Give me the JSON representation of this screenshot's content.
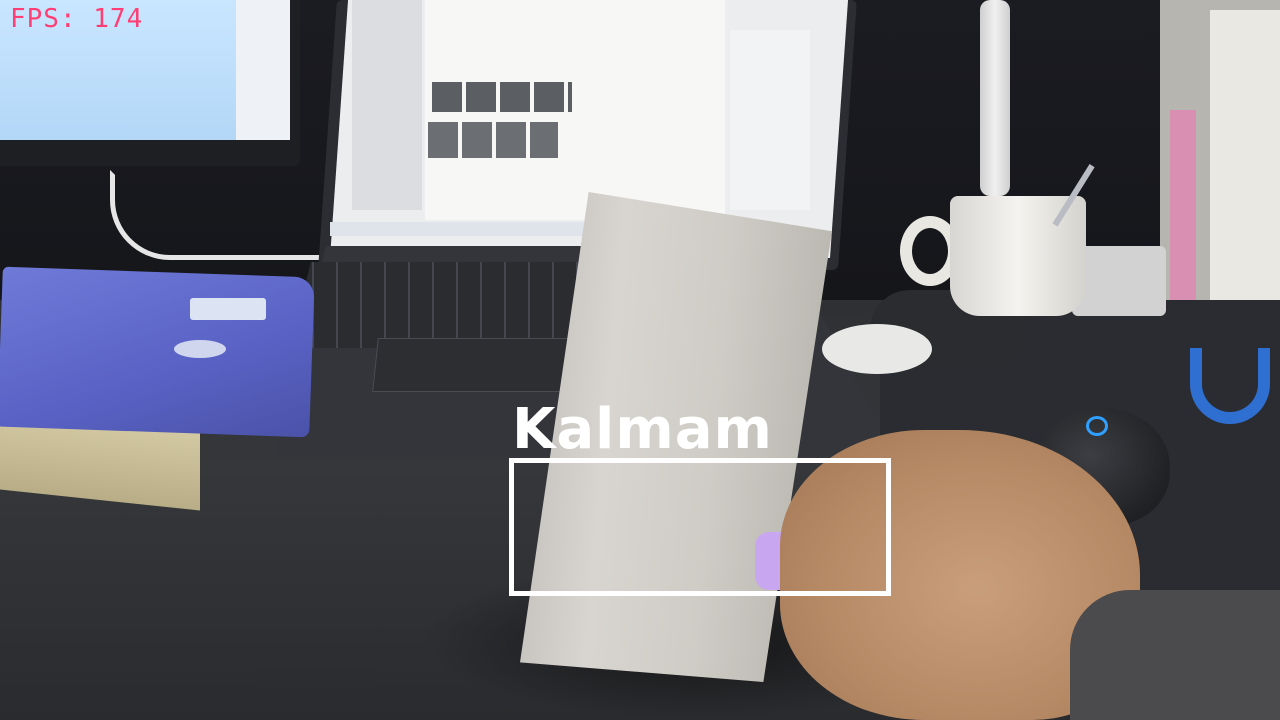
{
  "overlay": {
    "fps_text": "FPS: 174",
    "fps_color": "#ff3f73",
    "tracker_label": "Kalmam",
    "box_color": "#ffffff"
  },
  "scene": {
    "objects": [
      "monitor",
      "laptop",
      "book",
      "power-bank",
      "hand",
      "mug",
      "desk-lamp",
      "mouse",
      "mouse-pad",
      "books"
    ]
  }
}
